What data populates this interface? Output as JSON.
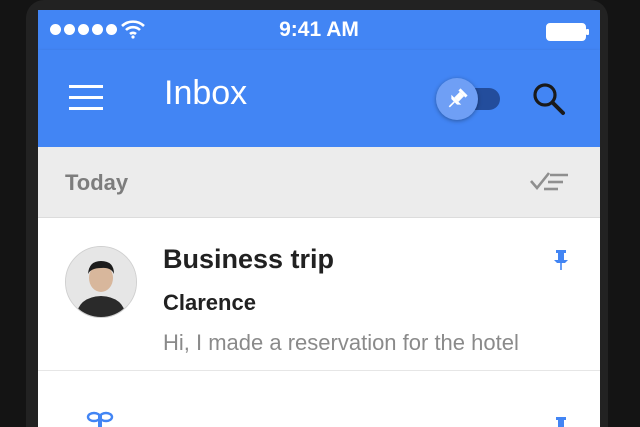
{
  "status_bar": {
    "time": "9:41 AM",
    "signal_icon": "signal-dots-icon",
    "wifi_icon": "wifi-icon",
    "battery_icon": "battery-icon"
  },
  "app_bar": {
    "title": "Inbox",
    "menu_icon": "hamburger-menu-icon",
    "pin_toggle_icon": "pin-icon",
    "search_icon": "search-icon"
  },
  "section": {
    "label": "Today",
    "sweep_icon": "sweep-done-icon"
  },
  "emails": [
    {
      "subject": "Business trip",
      "sender": "Clarence",
      "snippet": "Hi, I made a reservation for the hotel",
      "pinned": true
    },
    {
      "subject": "",
      "pinned": true
    }
  ],
  "colors": {
    "primary": "#4285f4",
    "pin": "#4285f4",
    "section_bg": "#ececec",
    "text_primary": "#212121",
    "text_secondary": "#8a8a8a"
  }
}
